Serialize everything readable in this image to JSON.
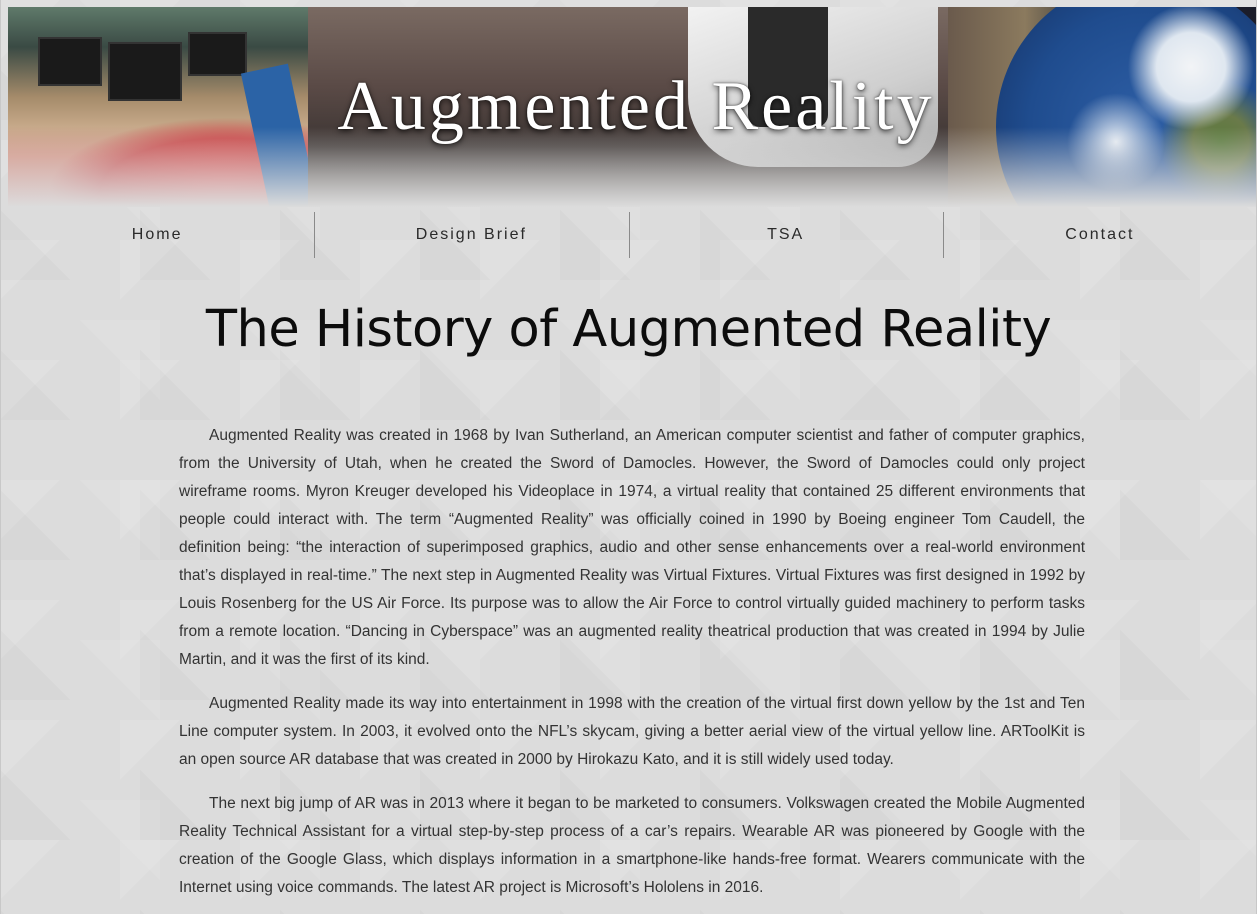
{
  "banner": {
    "title": "Augmented Reality"
  },
  "nav": {
    "items": [
      {
        "label": "Home"
      },
      {
        "label": "Design Brief"
      },
      {
        "label": "TSA"
      },
      {
        "label": "Contact"
      }
    ]
  },
  "main": {
    "title": "The History of Augmented Reality",
    "paragraphs": [
      "Augmented Reality was created in 1968 by Ivan Sutherland, an American computer scientist and father of computer graphics, from the University of Utah, when he created the Sword of Damocles. However, the Sword of Damocles could only project wireframe rooms. Myron Kreuger developed his Videoplace in 1974, a virtual reality that contained 25 different environments that people could interact with. The term “Augmented Reality” was officially coined in 1990 by Boeing engineer Tom Caudell, the definition being: “the interaction of superimposed graphics, audio and other sense enhancements over a real-world environment that’s displayed in real-time.” The next step in Augmented Reality was Virtual Fixtures. Virtual Fixtures was first designed in 1992 by Louis Rosenberg for the US Air Force. Its purpose was to allow the Air Force to control virtually guided machinery to perform tasks from a remote location. “Dancing in Cyberspace” was an augmented reality theatrical production that was created in 1994 by Julie Martin, and it was the first of its kind.",
      "Augmented Reality made its way into entertainment in 1998 with the creation of the virtual first down yellow by the 1st and Ten Line computer system. In 2003, it evolved onto the NFL’s skycam, giving a better aerial view of the virtual yellow line. ARToolKit is an open source AR database that was created in 2000 by Hirokazu Kato, and it is still widely used today.",
      "The next big jump of AR was in 2013 where it began to be marketed to consumers. Volkswagen created the Mobile Augmented Reality Technical Assistant for a virtual step-by-step process of a car’s repairs. Wearable AR was pioneered by Google with the creation of the Google Glass, which displays information in a smartphone-like hands-free format. Wearers communicate with the Internet using voice commands. The latest AR project is Microsoft’s Hololens in 2016."
    ]
  }
}
